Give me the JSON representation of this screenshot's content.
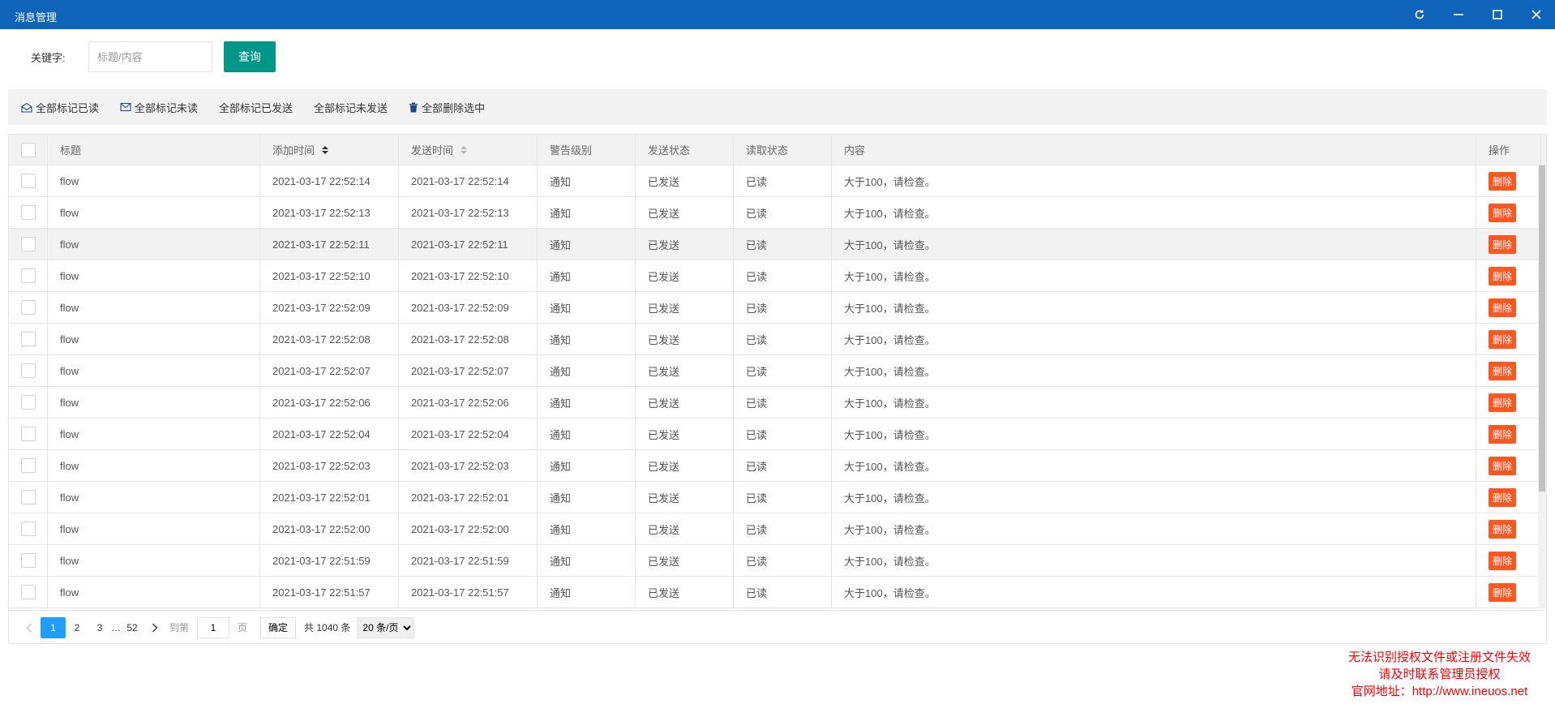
{
  "window": {
    "title": "消息管理"
  },
  "search": {
    "label": "关键字:",
    "placeholder": "标题/内容",
    "button": "查询"
  },
  "toolbar": [
    {
      "label": "全部标记已读",
      "icon": "envelope-open-icon"
    },
    {
      "label": "全部标记未读",
      "icon": "envelope-icon"
    },
    {
      "label": "全部标记已发送",
      "icon": ""
    },
    {
      "label": "全部标记未发送",
      "icon": ""
    },
    {
      "label": "全部删除选中",
      "icon": "trash-icon"
    }
  ],
  "table": {
    "headers": [
      "标题",
      "添加时间",
      "发送时间",
      "警告级别",
      "发送状态",
      "读取状态",
      "内容",
      "操作"
    ],
    "delete_label": "删除",
    "rows": [
      {
        "title": "flow",
        "add_time": "2021-03-17 22:52:14",
        "send_time": "2021-03-17 22:52:14",
        "level": "通知",
        "send_status": "已发送",
        "read_status": "已读",
        "content": "大于100，请检查。"
      },
      {
        "title": "flow",
        "add_time": "2021-03-17 22:52:13",
        "send_time": "2021-03-17 22:52:13",
        "level": "通知",
        "send_status": "已发送",
        "read_status": "已读",
        "content": "大于100，请检查。"
      },
      {
        "title": "flow",
        "add_time": "2021-03-17 22:52:11",
        "send_time": "2021-03-17 22:52:11",
        "level": "通知",
        "send_status": "已发送",
        "read_status": "已读",
        "content": "大于100，请检查。"
      },
      {
        "title": "flow",
        "add_time": "2021-03-17 22:52:10",
        "send_time": "2021-03-17 22:52:10",
        "level": "通知",
        "send_status": "已发送",
        "read_status": "已读",
        "content": "大于100，请检查。"
      },
      {
        "title": "flow",
        "add_time": "2021-03-17 22:52:09",
        "send_time": "2021-03-17 22:52:09",
        "level": "通知",
        "send_status": "已发送",
        "read_status": "已读",
        "content": "大于100，请检查。"
      },
      {
        "title": "flow",
        "add_time": "2021-03-17 22:52:08",
        "send_time": "2021-03-17 22:52:08",
        "level": "通知",
        "send_status": "已发送",
        "read_status": "已读",
        "content": "大于100，请检查。"
      },
      {
        "title": "flow",
        "add_time": "2021-03-17 22:52:07",
        "send_time": "2021-03-17 22:52:07",
        "level": "通知",
        "send_status": "已发送",
        "read_status": "已读",
        "content": "大于100，请检查。"
      },
      {
        "title": "flow",
        "add_time": "2021-03-17 22:52:06",
        "send_time": "2021-03-17 22:52:06",
        "level": "通知",
        "send_status": "已发送",
        "read_status": "已读",
        "content": "大于100，请检查。"
      },
      {
        "title": "flow",
        "add_time": "2021-03-17 22:52:04",
        "send_time": "2021-03-17 22:52:04",
        "level": "通知",
        "send_status": "已发送",
        "read_status": "已读",
        "content": "大于100，请检查。"
      },
      {
        "title": "flow",
        "add_time": "2021-03-17 22:52:03",
        "send_time": "2021-03-17 22:52:03",
        "level": "通知",
        "send_status": "已发送",
        "read_status": "已读",
        "content": "大于100，请检查。"
      },
      {
        "title": "flow",
        "add_time": "2021-03-17 22:52:01",
        "send_time": "2021-03-17 22:52:01",
        "level": "通知",
        "send_status": "已发送",
        "read_status": "已读",
        "content": "大于100，请检查。"
      },
      {
        "title": "flow",
        "add_time": "2021-03-17 22:52:00",
        "send_time": "2021-03-17 22:52:00",
        "level": "通知",
        "send_status": "已发送",
        "read_status": "已读",
        "content": "大于100，请检查。"
      },
      {
        "title": "flow",
        "add_time": "2021-03-17 22:51:59",
        "send_time": "2021-03-17 22:51:59",
        "level": "通知",
        "send_status": "已发送",
        "read_status": "已读",
        "content": "大于100，请检查。"
      },
      {
        "title": "flow",
        "add_time": "2021-03-17 22:51:57",
        "send_time": "2021-03-17 22:51:57",
        "level": "通知",
        "send_status": "已发送",
        "read_status": "已读",
        "content": "大于100，请检查。"
      }
    ]
  },
  "pagination": {
    "pages": [
      "1",
      "2",
      "3"
    ],
    "ellipsis": "…",
    "last_page": "52",
    "current_page": "1",
    "goto_label": "到第",
    "page_unit": "页",
    "confirm": "确定",
    "total": "共 1040 条",
    "page_size": "20 条/页"
  },
  "license": {
    "line1": "无法识别授权文件或注册文件失效",
    "line2": "请及时联系管理员授权",
    "line3": "官网地址：http://www.ineuos.net"
  },
  "colors": {
    "titlebar": "#0f64ba",
    "query_button": "#009688",
    "delete_button": "#ff5722",
    "active_page": "#1e9fff",
    "license_text": "#ff0000"
  }
}
